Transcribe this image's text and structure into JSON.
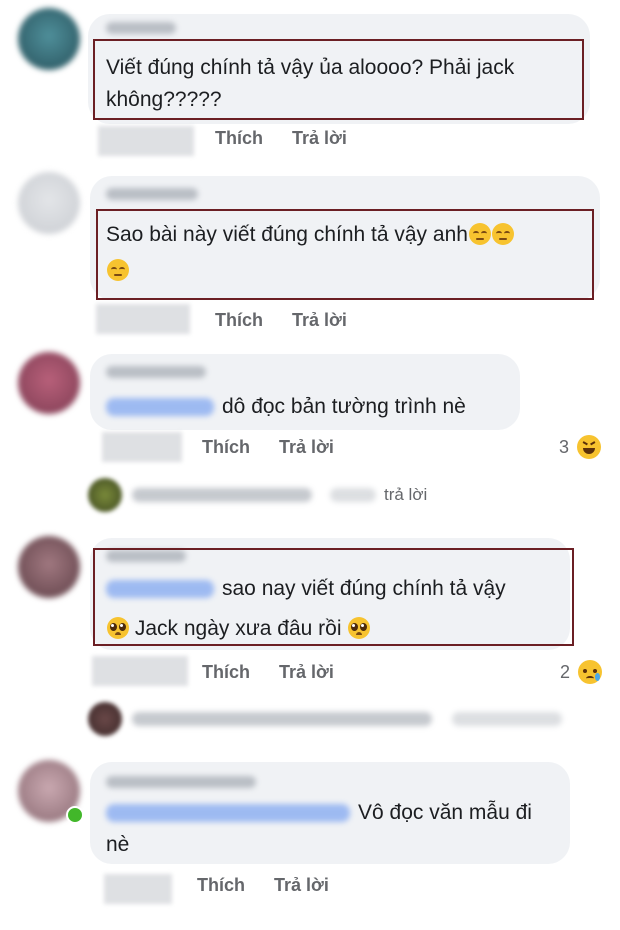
{
  "comments": [
    {
      "text_lines": [
        "Viết đúng chính tả vậy ủa aloooo? Phải jack",
        "không?????"
      ],
      "actions": {
        "like": "Thích",
        "reply": "Trả lời"
      }
    },
    {
      "text_lines": [
        "Sao bài này viết đúng chính tả vậy anh",
        ""
      ],
      "emoji": "unamused-face-icon",
      "actions": {
        "like": "Thích",
        "reply": "Trả lời"
      }
    },
    {
      "text_lines": [
        "dô đọc bản tường trình nè"
      ],
      "actions": {
        "like": "Thích",
        "reply": "Trả lời"
      },
      "reaction_count": "3",
      "reaction_icon": "laughing-face-icon",
      "reply_preview": {
        "label": "trả lời"
      }
    },
    {
      "text_lines": [
        "sao nay viết đúng chính tả vậy",
        "Jack ngày xưa đâu rồi"
      ],
      "emoji": "pleading-face-icon",
      "actions": {
        "like": "Thích",
        "reply": "Trả lời"
      },
      "reaction_count": "2",
      "reaction_icon": "crying-face-icon"
    },
    {
      "text_lines": [
        "Vô đọc văn mẫu đi",
        "nè"
      ],
      "actions": {
        "like": "Thích",
        "reply": "Trả lời"
      }
    }
  ],
  "colors": {
    "bubble": "#f0f2f5",
    "highlight_border": "#6b1f24",
    "action_text": "#65676b",
    "mention": "#5b8def"
  }
}
